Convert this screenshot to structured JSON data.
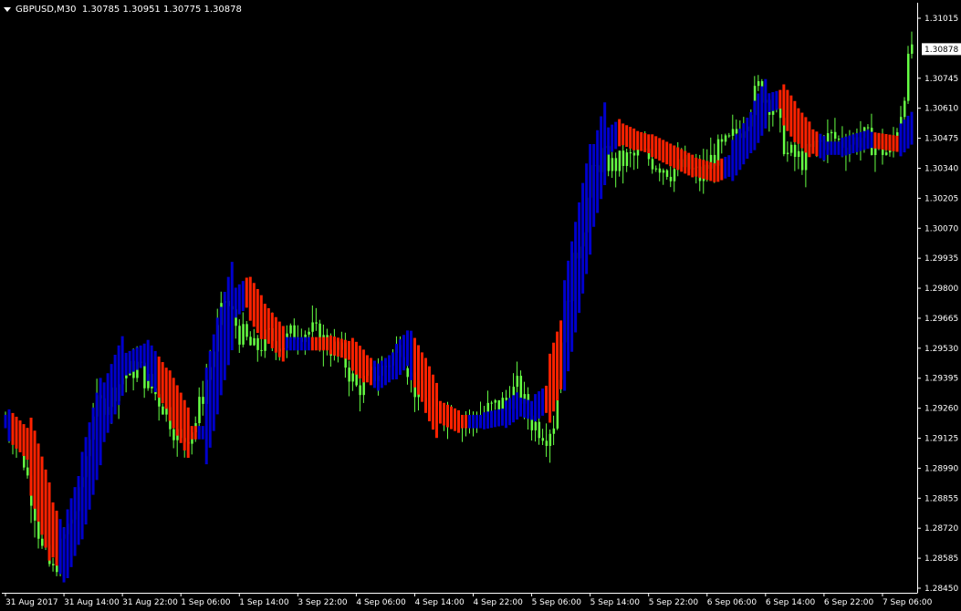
{
  "header": {
    "symbol": "GBPUSD,M30",
    "prices": "1.30785 1.30951 1.30775 1.30878"
  },
  "colors": {
    "background": "#000000",
    "bull_candle": "#66ff44",
    "bear_candle": "#66ff44",
    "band_up": "#0000cc",
    "band_down": "#ff2200",
    "axis": "#ffffff",
    "price_tag_bg": "#ffffff",
    "price_tag_text": "#000000"
  },
  "chart_data": {
    "type": "candlestick",
    "timeframe": "M30",
    "current_price": "1.30878",
    "y_ticks": [
      "1.31015",
      "1.30745",
      "1.30610",
      "1.30475",
      "1.30340",
      "1.30205",
      "1.30070",
      "1.29935",
      "1.29800",
      "1.29665",
      "1.29530",
      "1.29395",
      "1.29260",
      "1.29125",
      "1.28990",
      "1.28855",
      "1.28720",
      "1.28585",
      "1.28450"
    ],
    "y_tick_values": [
      1.31015,
      1.30745,
      1.3061,
      1.30475,
      1.3034,
      1.30205,
      1.3007,
      1.29935,
      1.298,
      1.29665,
      1.2953,
      1.29395,
      1.2926,
      1.29125,
      1.2899,
      1.28855,
      1.2872,
      1.28585,
      1.2845
    ],
    "ylim": [
      1.2845,
      1.31015
    ],
    "x_ticks": [
      "31 Aug 2017",
      "31 Aug 14:00",
      "31 Aug 22:00",
      "1 Sep 06:00",
      "1 Sep 14:00",
      "3 Sep 22:00",
      "4 Sep 06:00",
      "4 Sep 14:00",
      "4 Sep 22:00",
      "5 Sep 06:00",
      "5 Sep 14:00",
      "5 Sep 22:00",
      "6 Sep 06:00",
      "6 Sep 14:00",
      "6 Sep 22:00",
      "7 Sep 06:00"
    ],
    "x_tick_index": [
      0,
      16,
      32,
      48,
      64,
      80,
      96,
      112,
      128,
      144,
      160,
      176,
      192,
      208,
      224,
      240
    ],
    "bar_count": 249,
    "price_path": [
      [
        0,
        1.292
      ],
      [
        4,
        1.291
      ],
      [
        8,
        1.288
      ],
      [
        10,
        1.2862
      ],
      [
        13,
        1.2852
      ],
      [
        16,
        1.2868
      ],
      [
        20,
        1.2885
      ],
      [
        24,
        1.2925
      ],
      [
        28,
        1.293
      ],
      [
        32,
        1.294
      ],
      [
        36,
        1.2945
      ],
      [
        40,
        1.2935
      ],
      [
        44,
        1.2925
      ],
      [
        48,
        1.291
      ],
      [
        52,
        1.292
      ],
      [
        56,
        1.2945
      ],
      [
        60,
        1.2975
      ],
      [
        64,
        1.296
      ],
      [
        68,
        1.2952
      ],
      [
        72,
        1.2958
      ],
      [
        76,
        1.2955
      ],
      [
        80,
        1.2962
      ],
      [
        84,
        1.296
      ],
      [
        88,
        1.2955
      ],
      [
        92,
        1.295
      ],
      [
        96,
        1.2935
      ],
      [
        100,
        1.294
      ],
      [
        104,
        1.2945
      ],
      [
        108,
        1.2955
      ],
      [
        112,
        1.2935
      ],
      [
        116,
        1.2925
      ],
      [
        120,
        1.2925
      ],
      [
        124,
        1.2922
      ],
      [
        128,
        1.292
      ],
      [
        132,
        1.2925
      ],
      [
        136,
        1.2928
      ],
      [
        140,
        1.2935
      ],
      [
        144,
        1.292
      ],
      [
        148,
        1.2915
      ],
      [
        150,
        1.292
      ],
      [
        152,
        1.296
      ],
      [
        155,
        1.299
      ],
      [
        158,
        1.301
      ],
      [
        160,
        1.303
      ],
      [
        163,
        1.304
      ],
      [
        166,
        1.3035
      ],
      [
        170,
        1.3038
      ],
      [
        174,
        1.304
      ],
      [
        178,
        1.3037
      ],
      [
        182,
        1.3033
      ],
      [
        186,
        1.3035
      ],
      [
        190,
        1.303
      ],
      [
        194,
        1.304
      ],
      [
        198,
        1.3045
      ],
      [
        202,
        1.3055
      ],
      [
        206,
        1.307
      ],
      [
        210,
        1.3062
      ],
      [
        214,
        1.304
      ],
      [
        218,
        1.3038
      ],
      [
        222,
        1.3045
      ],
      [
        226,
        1.3048
      ],
      [
        230,
        1.3045
      ],
      [
        234,
        1.3048
      ],
      [
        238,
        1.3045
      ],
      [
        242,
        1.304
      ],
      [
        245,
        1.306
      ],
      [
        248,
        1.309
      ]
    ],
    "band_path": [
      [
        0,
        1.292
      ],
      [
        6,
        1.291
      ],
      [
        12,
        1.2875
      ],
      [
        16,
        1.286
      ],
      [
        20,
        1.288
      ],
      [
        26,
        1.292
      ],
      [
        32,
        1.2945
      ],
      [
        38,
        1.295
      ],
      [
        44,
        1.2935
      ],
      [
        50,
        1.2915
      ],
      [
        54,
        1.2915
      ],
      [
        58,
        1.2945
      ],
      [
        62,
        1.2972
      ],
      [
        66,
        1.2978
      ],
      [
        70,
        1.2967
      ],
      [
        76,
        1.2955
      ],
      [
        82,
        1.2955
      ],
      [
        88,
        1.2955
      ],
      [
        94,
        1.2952
      ],
      [
        98,
        1.2945
      ],
      [
        102,
        1.294
      ],
      [
        106,
        1.2945
      ],
      [
        110,
        1.2953
      ],
      [
        114,
        1.294
      ],
      [
        118,
        1.2925
      ],
      [
        124,
        1.292
      ],
      [
        130,
        1.292
      ],
      [
        136,
        1.2922
      ],
      [
        140,
        1.2927
      ],
      [
        144,
        1.2925
      ],
      [
        148,
        1.293
      ],
      [
        152,
        1.295
      ],
      [
        156,
        1.2985
      ],
      [
        160,
        1.302
      ],
      [
        164,
        1.3045
      ],
      [
        168,
        1.305
      ],
      [
        172,
        1.3047
      ],
      [
        176,
        1.3045
      ],
      [
        182,
        1.304
      ],
      [
        188,
        1.3035
      ],
      [
        194,
        1.3032
      ],
      [
        198,
        1.3035
      ],
      [
        204,
        1.305
      ],
      [
        208,
        1.3063
      ],
      [
        212,
        1.3065
      ],
      [
        216,
        1.3055
      ],
      [
        220,
        1.3047
      ],
      [
        224,
        1.3043
      ],
      [
        228,
        1.3043
      ],
      [
        232,
        1.3045
      ],
      [
        236,
        1.3047
      ],
      [
        240,
        1.3046
      ],
      [
        244,
        1.3045
      ],
      [
        248,
        1.3052
      ]
    ],
    "band_width": 0.0006,
    "band_down_segments": [
      [
        2,
        14
      ],
      [
        42,
        52
      ],
      [
        66,
        76
      ],
      [
        84,
        100
      ],
      [
        112,
        126
      ],
      [
        148,
        152
      ],
      [
        168,
        196
      ],
      [
        212,
        222
      ],
      [
        238,
        244
      ]
    ]
  }
}
